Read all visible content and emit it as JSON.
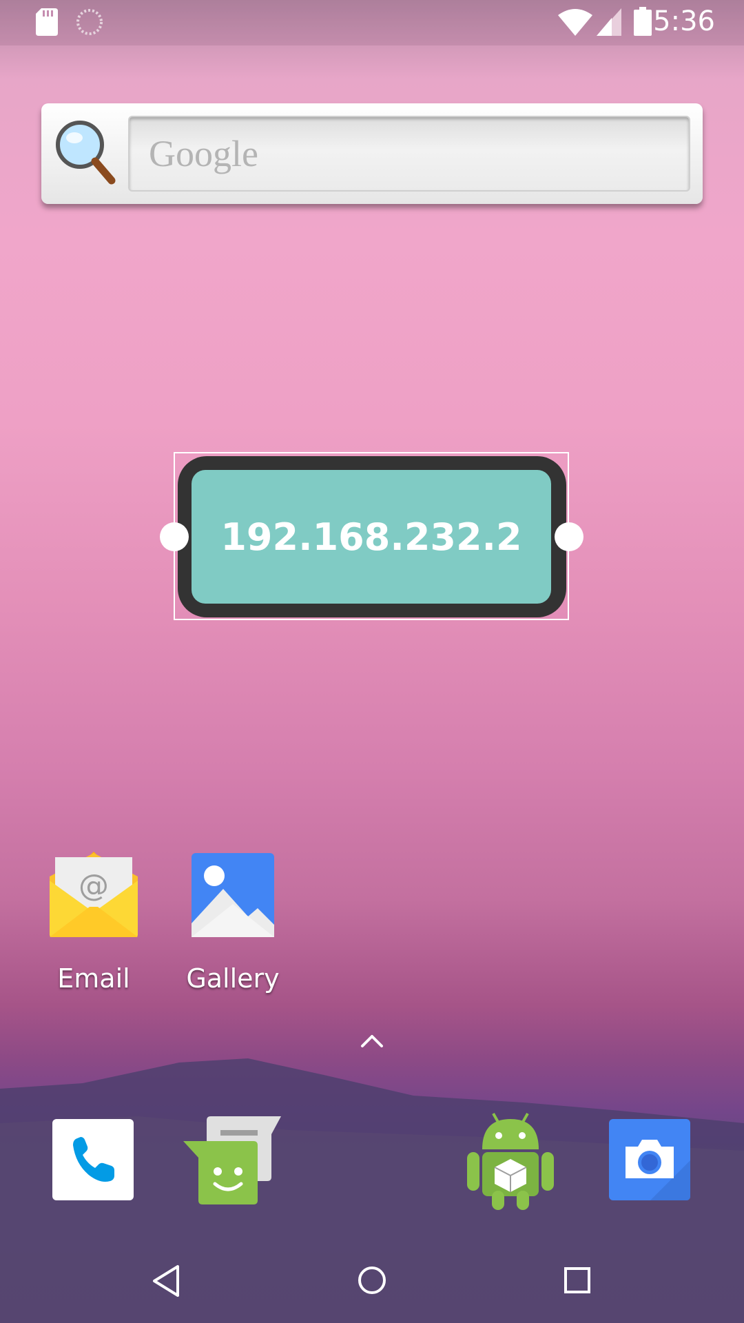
{
  "status_bar": {
    "time": "5:36",
    "icons": [
      "sd-card-icon",
      "sync-icon",
      "wifi-icon",
      "signal-icon",
      "battery-icon"
    ]
  },
  "google_widget": {
    "placeholder": "Google",
    "icon": "search-icon"
  },
  "ip_widget": {
    "address": "192.168.232.2",
    "colors": {
      "frame": "#333333",
      "fill": "#80cbc4"
    }
  },
  "apps": [
    {
      "label": "Email",
      "icon": "email-icon"
    },
    {
      "label": "Gallery",
      "icon": "gallery-icon"
    }
  ],
  "app_drawer": {
    "icon": "chevron-up-icon"
  },
  "dock": [
    {
      "name": "Phone",
      "icon": "phone-icon"
    },
    {
      "name": "Messaging",
      "icon": "messaging-icon"
    },
    {
      "name": "Android app",
      "icon": "android-icon"
    },
    {
      "name": "Camera",
      "icon": "camera-icon"
    }
  ],
  "nav_bar": {
    "icons": [
      "back-icon",
      "home-icon",
      "recents-icon"
    ]
  }
}
